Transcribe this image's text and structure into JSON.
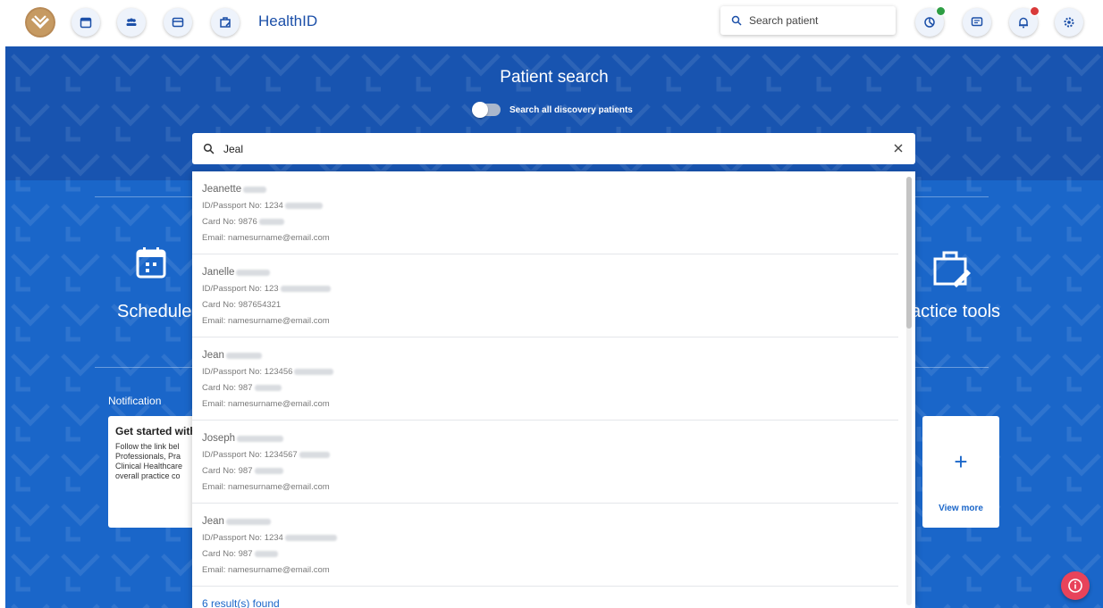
{
  "topbar": {
    "app_title": "HealthID",
    "search_placeholder": "Search patient",
    "icons": [
      "calendar-icon",
      "patients-icon",
      "card-icon",
      "practice-tools-icon",
      "analytics-icon",
      "messages-icon",
      "bell-icon",
      "settings-icon"
    ],
    "badge_colors": {
      "analytics": "#2e9e44",
      "bell": "#d93a3a"
    }
  },
  "main": {
    "title": "Patient search",
    "toggle_label": "Search all discovery patients",
    "toggle_on": false,
    "tiles": {
      "left_label": "Schedule",
      "right_label": "actice tools"
    },
    "notification": {
      "section_label": "Notification",
      "card_title": "Get started with",
      "card_body": "Follow the link bel Professionals, Pra Clinical Healthcare overall practice co"
    },
    "view_more": {
      "plus": "+",
      "label": "View more"
    }
  },
  "search": {
    "value": "Jeal",
    "results": [
      {
        "name": "Jeanette",
        "id": "ID/Passport No: 1234",
        "card": "Card No: 9876",
        "email": "Email: namesurname@email.com"
      },
      {
        "name": "Janelle",
        "id": "ID/Passport No: 123",
        "card": "Card No: 987654321",
        "email": "Email: namesurname@email.com"
      },
      {
        "name": "Jean",
        "id": "ID/Passport No: 123456",
        "card": "Card No: 987",
        "email": "Email: namesurname@email.com"
      },
      {
        "name": "Joseph",
        "id": "ID/Passport No: 1234567",
        "card": "Card No: 987",
        "email": "Email: namesurname@email.com"
      },
      {
        "name": "Jean",
        "id": "ID/Passport No: 1234",
        "card": "Card No: 987",
        "email": "Email: namesurname@email.com"
      }
    ],
    "count_text": "6 result(s) found"
  },
  "colors": {
    "brand_blue": "#1a66c9",
    "header_blue": "#1854b0",
    "logo_gold": "#b88a56",
    "info_red": "#e8435a"
  }
}
